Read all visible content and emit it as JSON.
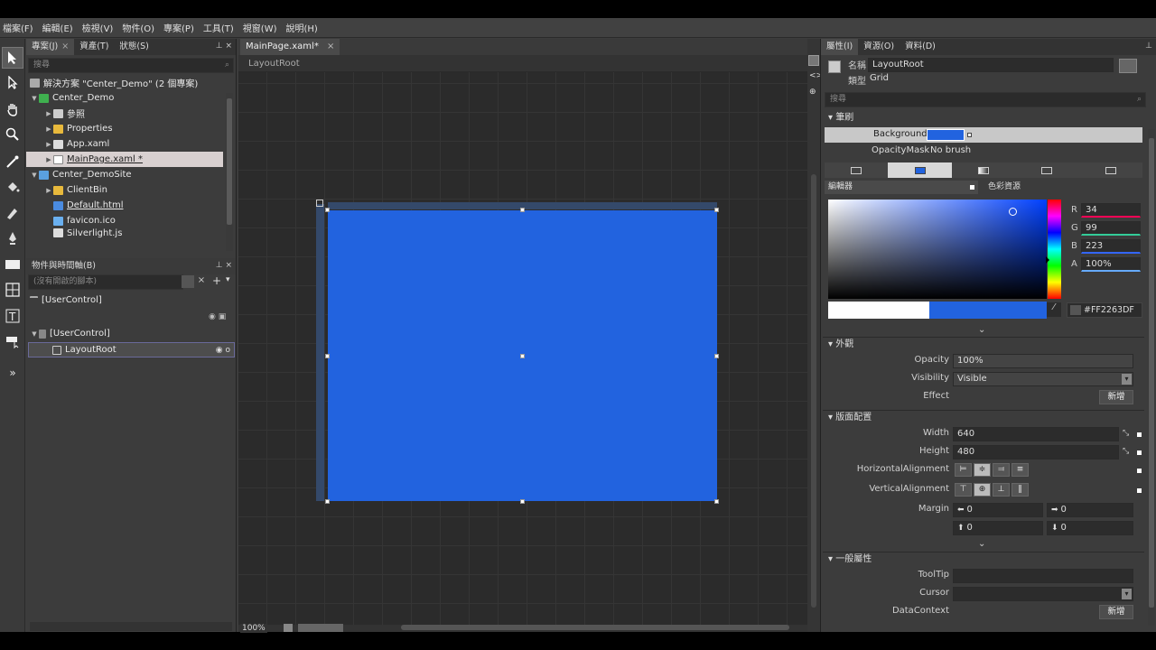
{
  "menu": [
    "檔案(F)",
    "編輯(E)",
    "檢視(V)",
    "物件(O)",
    "專案(P)",
    "工具(T)",
    "視窗(W)",
    "說明(H)"
  ],
  "left": {
    "tabs": [
      {
        "label": "專案(J)",
        "close": "×"
      },
      {
        "label": "資產(T)",
        "close": ""
      },
      {
        "label": "狀態(S)",
        "close": ""
      }
    ],
    "search_placeholder": "搜尋",
    "tree": [
      {
        "label": "解決方案 \"Center_Demo\" (2 個專案)"
      },
      {
        "label": "Center_Demo"
      },
      {
        "label": "參照"
      },
      {
        "label": "Properties"
      },
      {
        "label": "App.xaml"
      },
      {
        "label": "MainPage.xaml *"
      },
      {
        "label": "Center_DemoSite"
      },
      {
        "label": "ClientBin"
      },
      {
        "label": "Default.html"
      },
      {
        "label": "favicon.ico"
      },
      {
        "label": "Silverlight.js"
      }
    ],
    "objects_title": "物件與時間軸(B)",
    "no_script": "(沒有開啟的腳本)",
    "root_usercontrol": "[UserControl]",
    "usercontrol": "[UserControl]",
    "layoutroot": "LayoutRoot"
  },
  "doc": {
    "tab_label": "MainPage.xaml*",
    "tab_close": "×",
    "breadcrumb": "LayoutRoot",
    "zoom": "100%",
    "artboard_color": "#2263df"
  },
  "right": {
    "tabs": [
      "屬性(I)",
      "資源(O)",
      "資料(D)"
    ],
    "name_label": "名稱",
    "name_value": "LayoutRoot",
    "type_label": "類型",
    "type_value": "Grid",
    "search_placeholder": "搜尋",
    "brush_section": "筆刷",
    "background_label": "Background",
    "opacitymask_label": "OpacityMask",
    "opacitymask_value": "No brush",
    "editor_tab": "編輯器",
    "color_resources_tab": "色彩資源",
    "r_label": "R",
    "r_value": "34",
    "g_label": "G",
    "g_value": "99",
    "b_label": "B",
    "b_value": "223",
    "a_label": "A",
    "a_value": "100%",
    "hex_value": "#FF2263DF",
    "appearance_section": "外觀",
    "opacity_label": "Opacity",
    "opacity_value": "100%",
    "visibility_label": "Visibility",
    "visibility_value": "Visible",
    "effect_label": "Effect",
    "new_label": "新增",
    "layout_section": "版面配置",
    "width_label": "Width",
    "width_value": "640",
    "height_label": "Height",
    "height_value": "480",
    "halign_label": "HorizontalAlignment",
    "valign_label": "VerticalAlignment",
    "margin_label": "Margin",
    "margin_left": "0",
    "margin_right": "0",
    "margin_top": "0",
    "margin_bottom": "0",
    "common_section": "一般屬性",
    "tooltip_label": "ToolTip",
    "cursor_label": "Cursor",
    "datacontext_label": "DataContext",
    "new_label2": "新增"
  },
  "colors": {
    "accent": "#2263df",
    "selected_row": "#d8d0d0"
  }
}
